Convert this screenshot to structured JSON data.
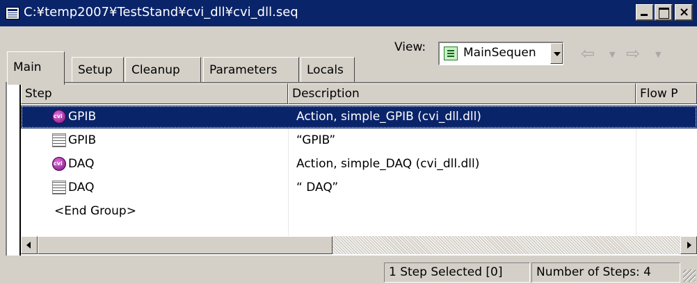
{
  "window": {
    "title": "C:¥temp2007¥TestStand¥cvi_dll¥cvi_dll.seq"
  },
  "tabs": [
    {
      "label": "Main",
      "active": true
    },
    {
      "label": "Setup",
      "active": false
    },
    {
      "label": "Cleanup",
      "active": false
    },
    {
      "label": "Parameters",
      "active": false
    },
    {
      "label": "Locals",
      "active": false
    }
  ],
  "view": {
    "label": "View:",
    "selected": "MainSequen"
  },
  "columns": [
    "Step",
    "Description",
    "Flow P"
  ],
  "rows": [
    {
      "icon": "cvi-action-icon",
      "step": "GPIB",
      "description": "Action,  simple_GPIB (cvi_dll.dll)",
      "selected": true
    },
    {
      "icon": "message-popup-icon",
      "step": "GPIB",
      "description": "“GPIB”",
      "selected": false
    },
    {
      "icon": "cvi-action-icon",
      "step": "DAQ",
      "description": "Action,  simple_DAQ (cvi_dll.dll)",
      "selected": false
    },
    {
      "icon": "message-popup-icon",
      "step": "DAQ",
      "description": "“ DAQ”",
      "selected": false
    },
    {
      "icon": "",
      "step": "<End Group>",
      "description": "",
      "selected": false
    }
  ],
  "status": {
    "selected": "1 Step Selected [0]",
    "count": "Number of Steps: 4"
  },
  "colors": {
    "titlebar": "#0a246a",
    "selection": "#0a246a",
    "face": "#d4d0c8"
  }
}
